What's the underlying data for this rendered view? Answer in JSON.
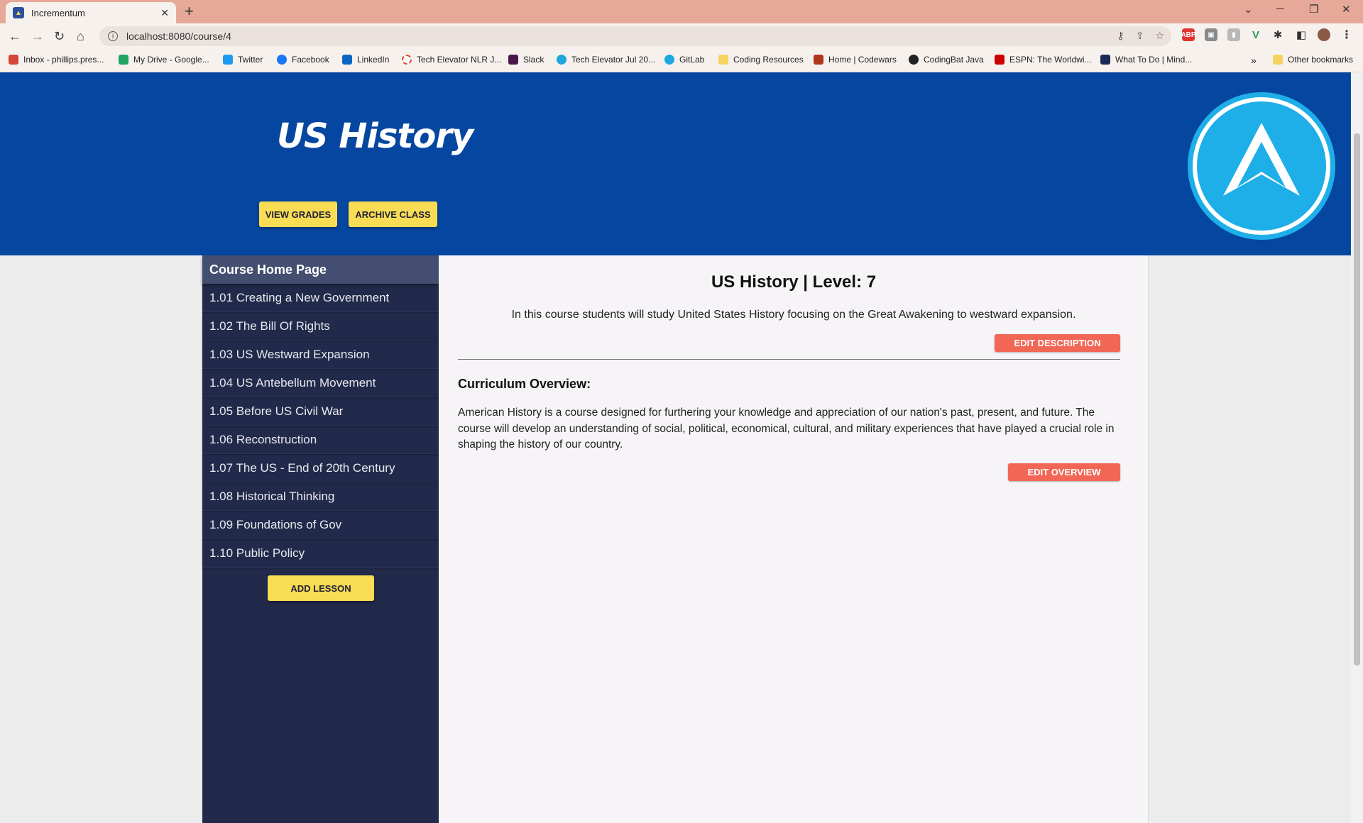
{
  "browser": {
    "tab_title": "Incrementum",
    "url": "localhost:8080/course/4",
    "bookmarks": [
      {
        "label": "Inbox - phillips.pres...",
        "color": "#d44638"
      },
      {
        "label": "My Drive - Google...",
        "color": "#1fa463"
      },
      {
        "label": "Twitter",
        "color": "#1d9bf0"
      },
      {
        "label": "Facebook",
        "color": "#1877f2"
      },
      {
        "label": "LinkedIn",
        "color": "#0a66c2"
      },
      {
        "label": "Tech Elevator NLR J...",
        "color": "#e04b3a"
      },
      {
        "label": "Slack",
        "color": "#4a154b"
      },
      {
        "label": "Tech Elevator Jul 20...",
        "color": "#1fa8e0"
      },
      {
        "label": "GitLab",
        "color": "#1fa8e0"
      },
      {
        "label": "Coding Resources",
        "color": "#f4d35e"
      },
      {
        "label": "Home | Codewars",
        "color": "#b1361e"
      },
      {
        "label": "CodingBat Java",
        "color": "#222222"
      },
      {
        "label": "ESPN: The Worldwi...",
        "color": "#cc0000"
      },
      {
        "label": "What To Do | Mind...",
        "color": "#1b2a55"
      }
    ],
    "other_bookmarks": "Other bookmarks",
    "overflow": "»"
  },
  "header": {
    "course_title": "US History",
    "view_grades_label": "VIEW GRADES",
    "archive_class_label": "ARCHIVE CLASS"
  },
  "sidebar": {
    "home_label": "Course Home Page",
    "lessons": [
      "1.01 Creating a New Government",
      "1.02 The Bill Of Rights",
      "1.03 US Westward Expansion",
      "1.04 US Antebellum Movement",
      "1.05 Before US Civil War",
      "1.06 Reconstruction",
      "1.07 The US - End of 20th Century",
      "1.08 Historical Thinking",
      "1.09 Foundations of Gov",
      "1.10 Public Policy"
    ],
    "add_lesson_label": "ADD LESSON"
  },
  "main": {
    "title": "US History | Level: 7",
    "description": "In this course students will study United States History focusing on the Great Awakening to westward expansion.",
    "edit_description_label": "EDIT DESCRIPTION",
    "curriculum_heading": "Curriculum Overview:",
    "curriculum_text": "American History is a course designed for furthering your knowledge and appreciation of our nation's past, present, and future. The course will develop an understanding of social, political, economical, cultural, and military experiences that have played a crucial role in shaping the history of our country.",
    "edit_overview_label": "EDIT OVERVIEW"
  },
  "colors": {
    "hero_blue": "#0547a0",
    "sidebar_navy": "#212a4a",
    "button_yellow": "#f7dc54",
    "button_red": "#f26655",
    "logo_cyan": "#1eaee8"
  }
}
